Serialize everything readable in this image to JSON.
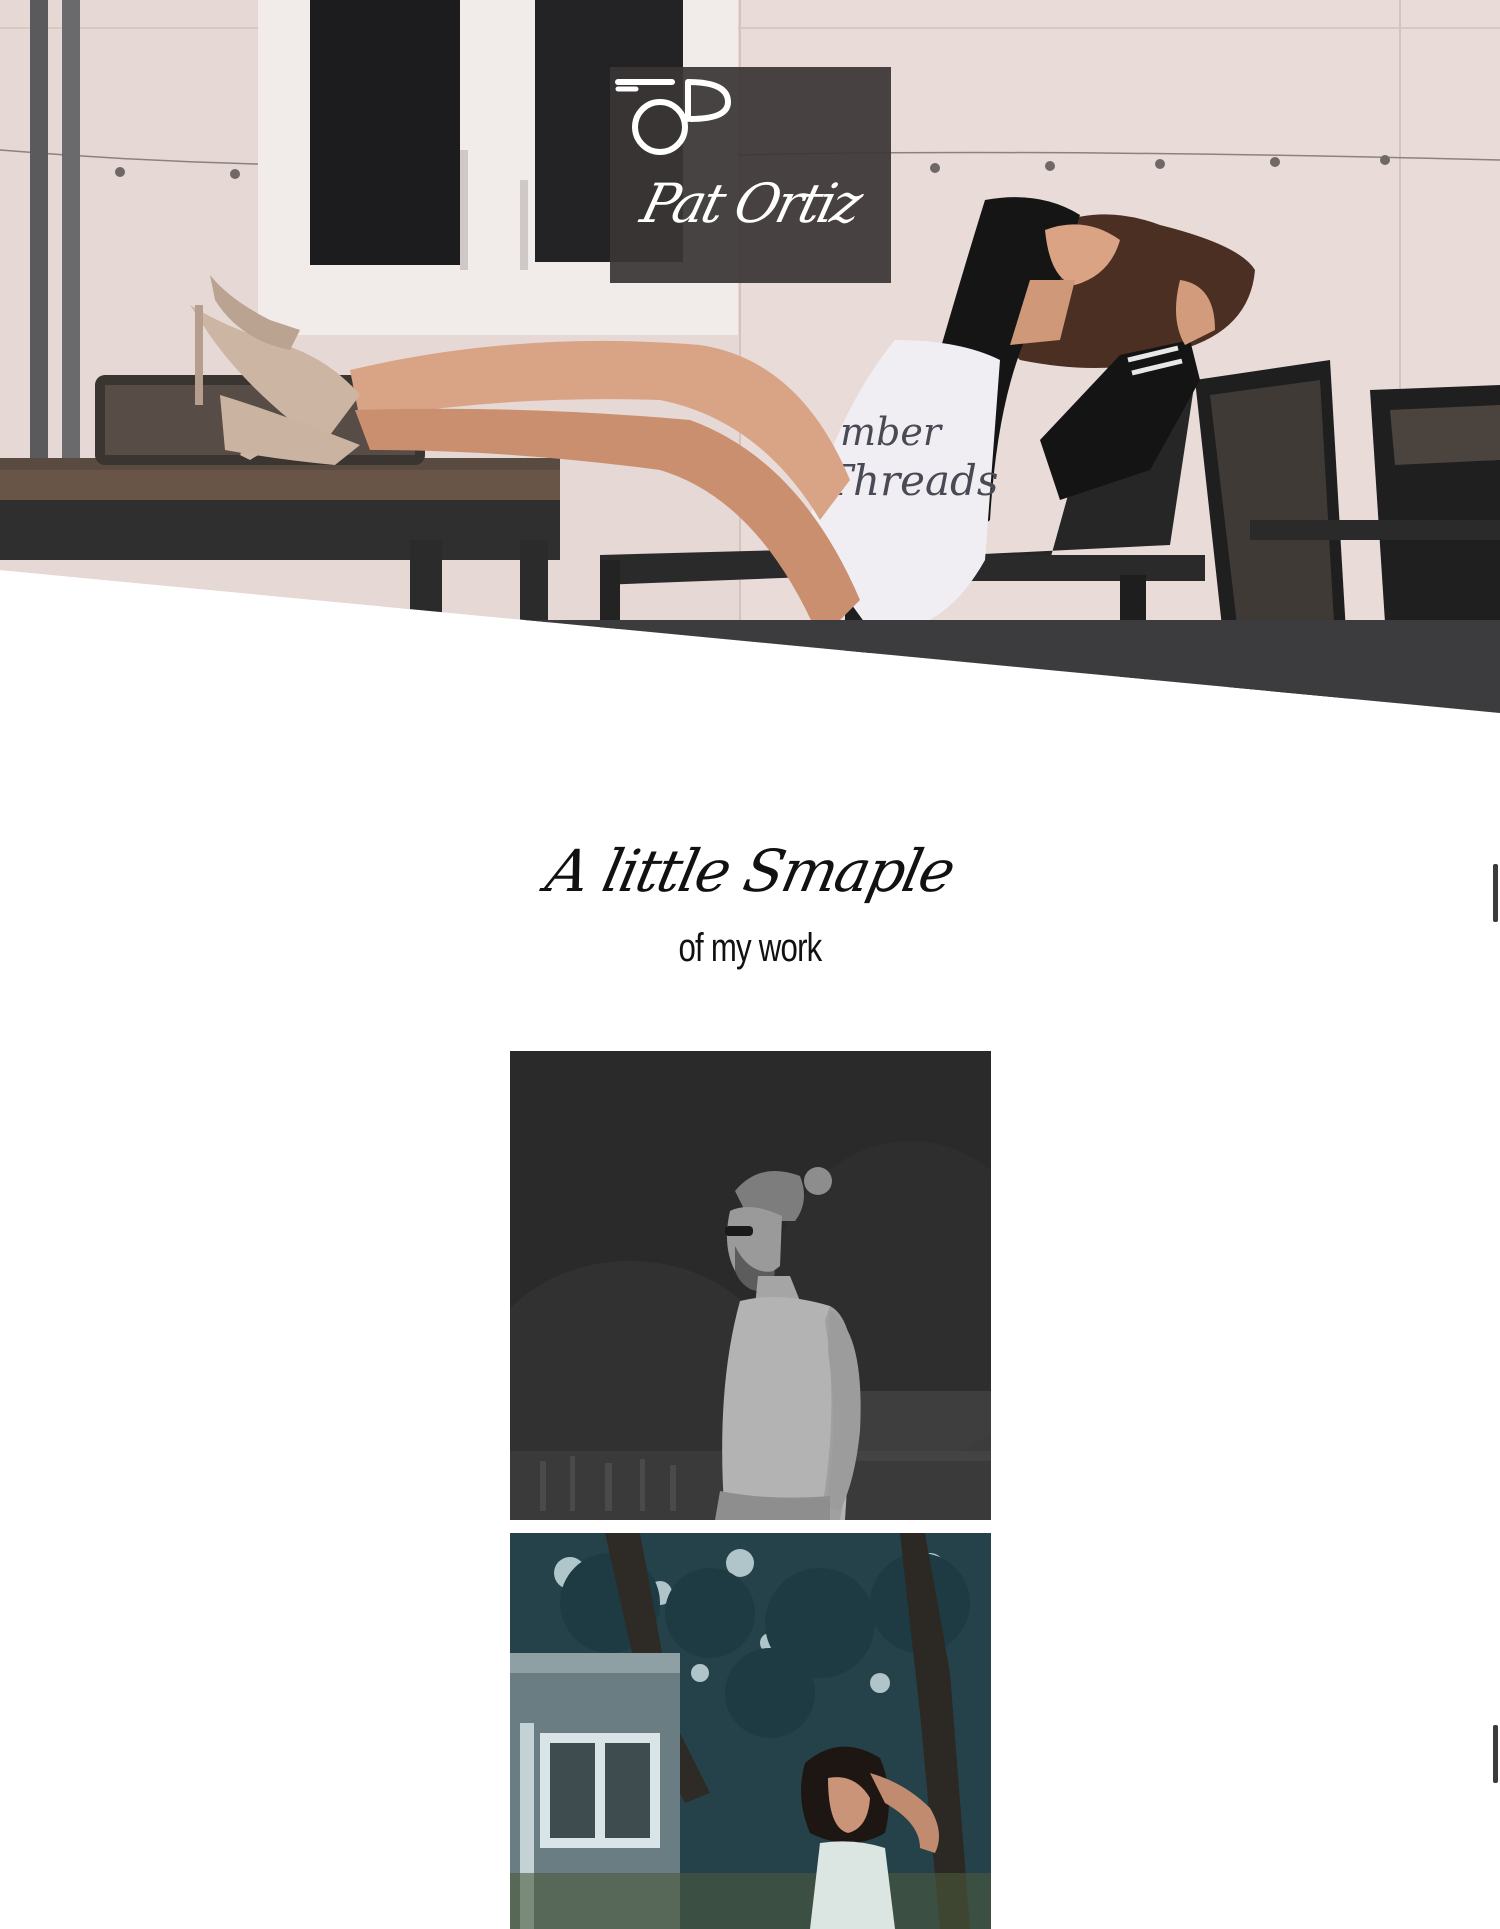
{
  "brand": {
    "name": "Pat Ortiz",
    "mark_icon": "camera-monogram-icon"
  },
  "hero": {
    "shirt_text_line1": "mber",
    "shirt_text_line2": "Threads"
  },
  "section": {
    "script_title": "A little Smaple",
    "subtitle": "of my work"
  },
  "gallery": {
    "items": [
      {
        "name": "portrait-man-monochrome"
      },
      {
        "name": "portrait-woman-outdoors"
      }
    ]
  },
  "colors": {
    "logo_box": "#3a3635",
    "page_background": "#ffffff",
    "text": "#111111"
  }
}
